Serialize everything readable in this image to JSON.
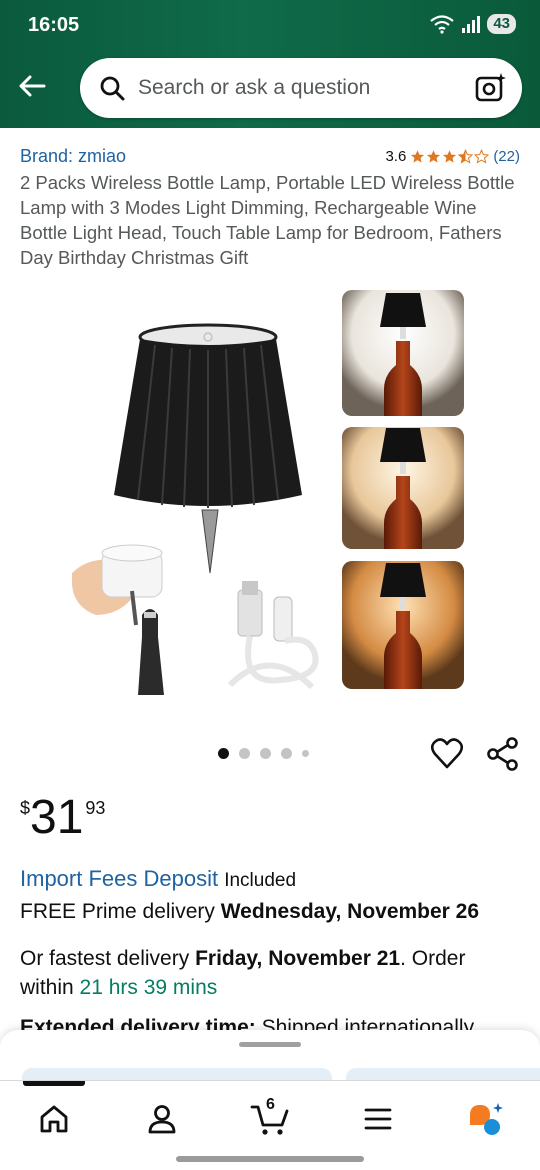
{
  "status_bar": {
    "time": "16:05",
    "battery": "43",
    "icons": [
      "wifi-icon",
      "signal-icon"
    ]
  },
  "header": {
    "search_placeholder": "Search or ask a question",
    "icons": [
      "back-arrow-icon",
      "search-icon",
      "camera-search-icon"
    ]
  },
  "product": {
    "brand": "Brand: zmiao",
    "rating_value": "3.6",
    "rating_stars": 3.5,
    "rating_count": "(22)",
    "title": "2 Packs Wireless Bottle Lamp, Portable LED Wireless Bottle Lamp with 3 Modes Light Dimming, Rechargeable Wine Bottle Light Head, Touch Table Lamp for Bedroom, Fathers Day Birthday Christmas Gift"
  },
  "gallery": {
    "image_count": 5,
    "active_index": 0
  },
  "price": {
    "currency": "$",
    "whole": "31",
    "fraction": "93"
  },
  "import": {
    "link": "Import Fees Deposit",
    "status": "Included"
  },
  "delivery": {
    "prime_prefix": "FREE Prime delivery ",
    "prime_date": "Wednesday, November 26",
    "fastest_prefix": "Or fastest delivery ",
    "fastest_date": "Friday, November 21",
    "order_within_prefix": ". Order within ",
    "countdown": "21 hrs 39 mins"
  },
  "extended_delivery": {
    "label": "Extended delivery time:",
    "text": " Shipped internationally"
  },
  "bottom_nav": {
    "cart_count": "6",
    "items": [
      "home-icon",
      "account-icon",
      "cart-icon",
      "menu-icon",
      "rufus-ai-icon"
    ]
  },
  "colors": {
    "header_green": "#0b5a3d",
    "link_blue": "#2162a1",
    "star_orange": "#de7921",
    "countdown_green": "#067d62"
  }
}
